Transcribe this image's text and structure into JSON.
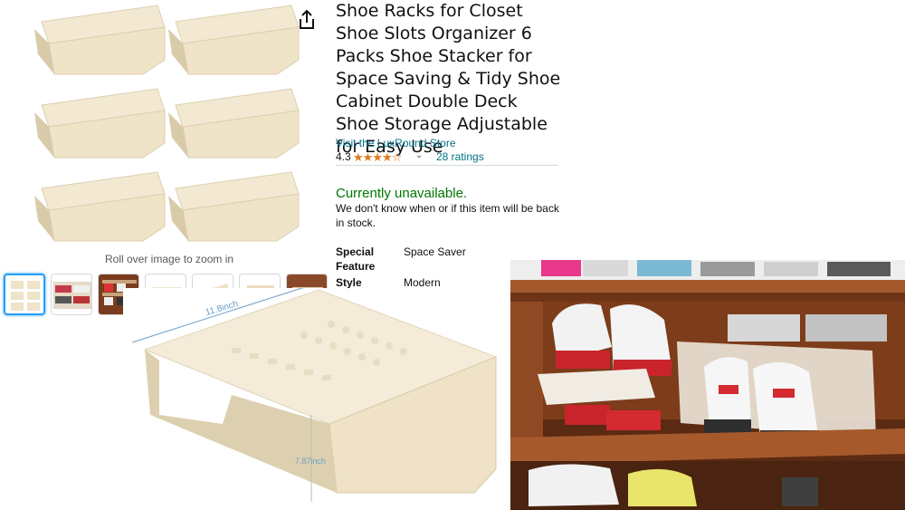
{
  "product": {
    "title": "Shoe Racks for Closet Shoe Slots Organizer 6 Packs Shoe Stacker for Space Saving & Tidy Shoe Cabinet Double Deck Shoe Storage Adjustable for Easy Use",
    "store_link": "Visit the LuxRound Store",
    "rating": "4.3",
    "stars": "★★★★☆",
    "chevron": "⌄",
    "ratings_count": "28 ratings",
    "availability": "Currently unavailable.",
    "availability_note": "We don't know when or if this item will be back in stock.",
    "specs": [
      {
        "label": "Special Feature",
        "value": "Space Saver"
      },
      {
        "label": "Style",
        "value": "Modern"
      }
    ]
  },
  "gallery": {
    "zoom_hint": "Roll over image to zoom in",
    "thumbnail_count": 7,
    "selected_thumbnail": 1
  },
  "detail_image": {
    "width_label": "11.8inch",
    "height_label": "7.87inch"
  },
  "colors": {
    "accent_link": "#007185",
    "availability_green": "#007600",
    "star_orange": "#de7921",
    "rack_beige": "#efe3c8",
    "thumbnail_selected": "#2a9df4"
  }
}
